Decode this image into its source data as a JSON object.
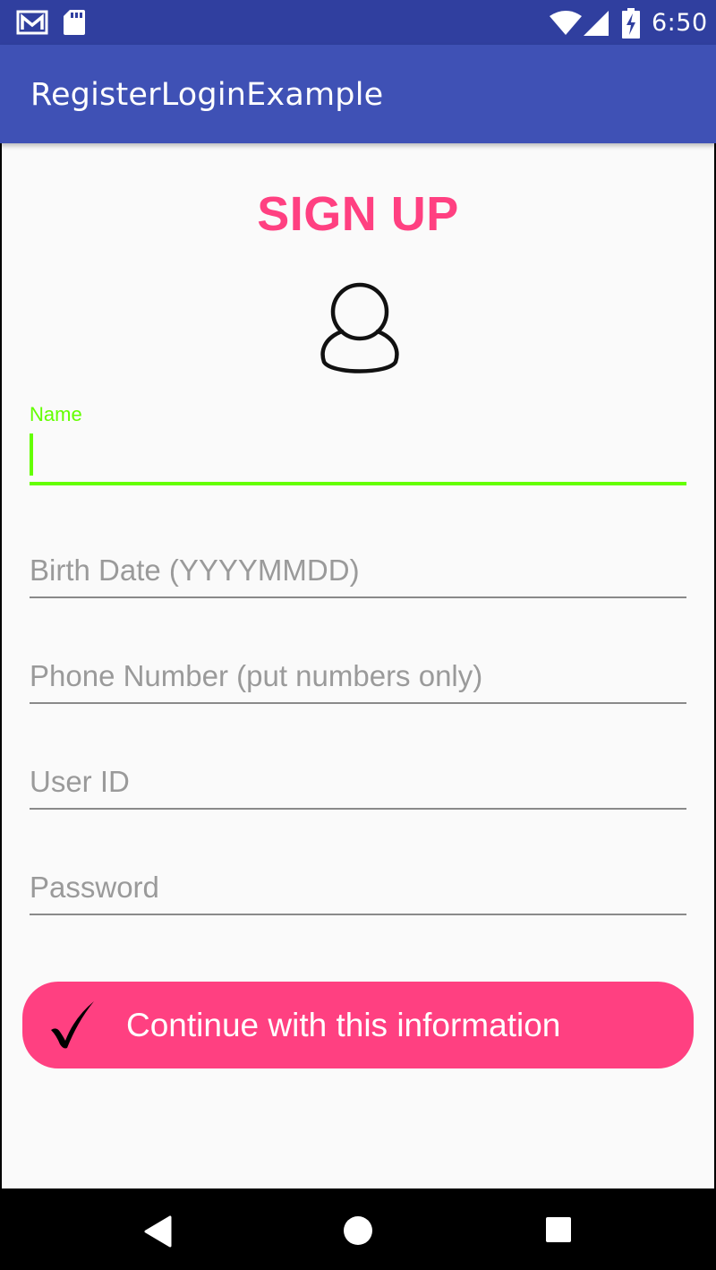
{
  "status_bar": {
    "time": "6:50",
    "icons": [
      "gmail-icon",
      "sd-card-icon",
      "wifi-icon",
      "cell-signal-icon",
      "battery-charging-icon"
    ]
  },
  "app_bar": {
    "title": "RegisterLoginExample"
  },
  "form": {
    "title": "SIGN UP",
    "avatar_icon": "user-avatar-icon",
    "name_label": "Name",
    "name_value": "",
    "birth_date_placeholder": "Birth Date (YYYYMMDD)",
    "phone_placeholder": "Phone Number (put numbers only)",
    "user_id_placeholder": "User ID",
    "password_placeholder": "Password"
  },
  "continue_button": {
    "icon": "checkmark-icon",
    "label": "Continue with this information"
  },
  "nav_bar": {
    "icons": [
      "back-icon",
      "home-icon",
      "recents-icon"
    ]
  },
  "colors": {
    "status_bar": "#303f9f",
    "app_bar": "#3f51b5",
    "accent": "#ff4081",
    "focus": "#64ff00",
    "background": "#fafafa"
  }
}
